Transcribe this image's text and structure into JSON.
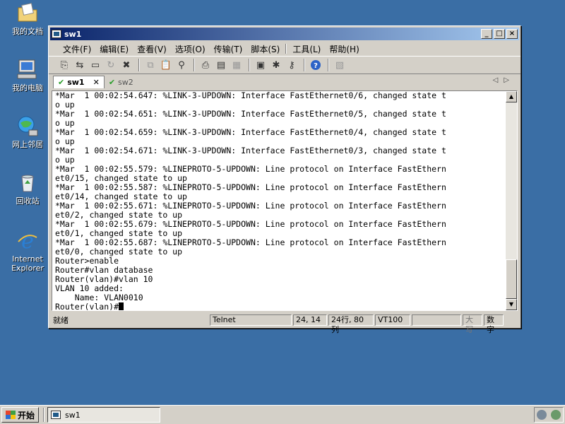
{
  "desktop": {
    "icons": [
      {
        "label": "我的文档",
        "icon": "folder-icon"
      },
      {
        "label": "我的电脑",
        "icon": "computer-icon"
      },
      {
        "label": "网上邻居",
        "icon": "network-icon"
      },
      {
        "label": "回收站",
        "icon": "recycle-bin-icon"
      },
      {
        "label": "Internet Explorer",
        "icon": "internet-explorer-icon"
      }
    ]
  },
  "window": {
    "title": "sw1",
    "menu": [
      "文件(F)",
      "编辑(E)",
      "查看(V)",
      "选项(O)",
      "传输(T)",
      "脚本(S)",
      "工具(L)",
      "帮助(H)"
    ],
    "tabs": [
      {
        "label": "sw1",
        "active": true
      },
      {
        "label": "sw2",
        "active": false
      }
    ],
    "terminal_lines": [
      "*Mar  1 00:02:54.647: %LINK-3-UPDOWN: Interface FastEthernet0/6, changed state t",
      "o up",
      "*Mar  1 00:02:54.651: %LINK-3-UPDOWN: Interface FastEthernet0/5, changed state t",
      "o up",
      "*Mar  1 00:02:54.659: %LINK-3-UPDOWN: Interface FastEthernet0/4, changed state t",
      "o up",
      "*Mar  1 00:02:54.671: %LINK-3-UPDOWN: Interface FastEthernet0/3, changed state t",
      "o up",
      "*Mar  1 00:02:55.579: %LINEPROTO-5-UPDOWN: Line protocol on Interface FastEthern",
      "et0/15, changed state to up",
      "*Mar  1 00:02:55.587: %LINEPROTO-5-UPDOWN: Line protocol on Interface FastEthern",
      "et0/14, changed state to up",
      "*Mar  1 00:02:55.671: %LINEPROTO-5-UPDOWN: Line protocol on Interface FastEthern",
      "et0/2, changed state to up",
      "*Mar  1 00:02:55.679: %LINEPROTO-5-UPDOWN: Line protocol on Interface FastEthern",
      "et0/1, changed state to up",
      "*Mar  1 00:02:55.687: %LINEPROTO-5-UPDOWN: Line protocol on Interface FastEthern",
      "et0/0, changed state to up",
      "Router>enable",
      "Router#vlan database",
      "Router(vlan)#vlan 10",
      "VLAN 10 added:",
      "    Name: VLAN0010"
    ],
    "prompt": "Router(vlan)#",
    "status": {
      "ready": "就绪",
      "protocol": "Telnet",
      "position": "24, 14",
      "size": "24行, 80列",
      "emulation": "VT100",
      "caps": "大写",
      "num": "数字"
    }
  },
  "taskbar": {
    "start_label": "开始",
    "task_label": "sw1"
  }
}
